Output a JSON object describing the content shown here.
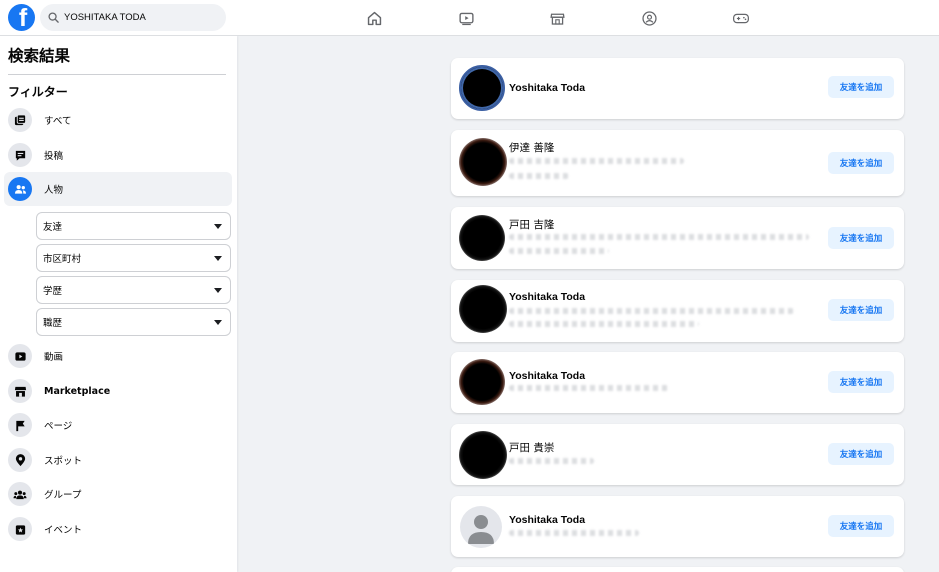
{
  "header": {
    "logo_letter": "f",
    "search_value": "YOSHITAKA TODA",
    "nav_icons": [
      "home-icon",
      "watch-icon",
      "marketplace-icon",
      "groups-icon",
      "gaming-icon"
    ]
  },
  "sidebar": {
    "title": "検索結果",
    "filter_heading": "フィルター",
    "items": [
      {
        "label": "すべて",
        "icon": "all-icon"
      },
      {
        "label": "投稿",
        "icon": "posts-icon"
      },
      {
        "label": "人物",
        "icon": "people-icon",
        "active": true
      },
      {
        "label": "動画",
        "icon": "video-icon"
      },
      {
        "label": "Marketplace",
        "icon": "marketplace-icon"
      },
      {
        "label": "ページ",
        "icon": "flag-icon"
      },
      {
        "label": "スポット",
        "icon": "location-icon"
      },
      {
        "label": "グループ",
        "icon": "groups-icon"
      },
      {
        "label": "イベント",
        "icon": "event-icon"
      }
    ],
    "dropdowns": [
      {
        "label": "友達"
      },
      {
        "label": "市区町村"
      },
      {
        "label": "学歴"
      },
      {
        "label": "職歴"
      }
    ]
  },
  "results": [
    {
      "name": "Yoshitaka Toda",
      "button": "友達を追加"
    },
    {
      "name": "伊達 善隆",
      "button": "友達を追加"
    },
    {
      "name": "戸田 吉隆",
      "button": "友達を追加"
    },
    {
      "name": "Yoshitaka Toda",
      "button": "友達を追加"
    },
    {
      "name": "Yoshitaka Toda",
      "button": "友達を追加"
    },
    {
      "name": "戸田 貴崇",
      "button": "友達を追加"
    },
    {
      "name": "Yoshitaka Toda",
      "button": "友達を追加"
    }
  ],
  "colors": {
    "brand": "#1877f2",
    "page_bg": "#f0f2f5",
    "button_bg": "#e7f3ff"
  }
}
